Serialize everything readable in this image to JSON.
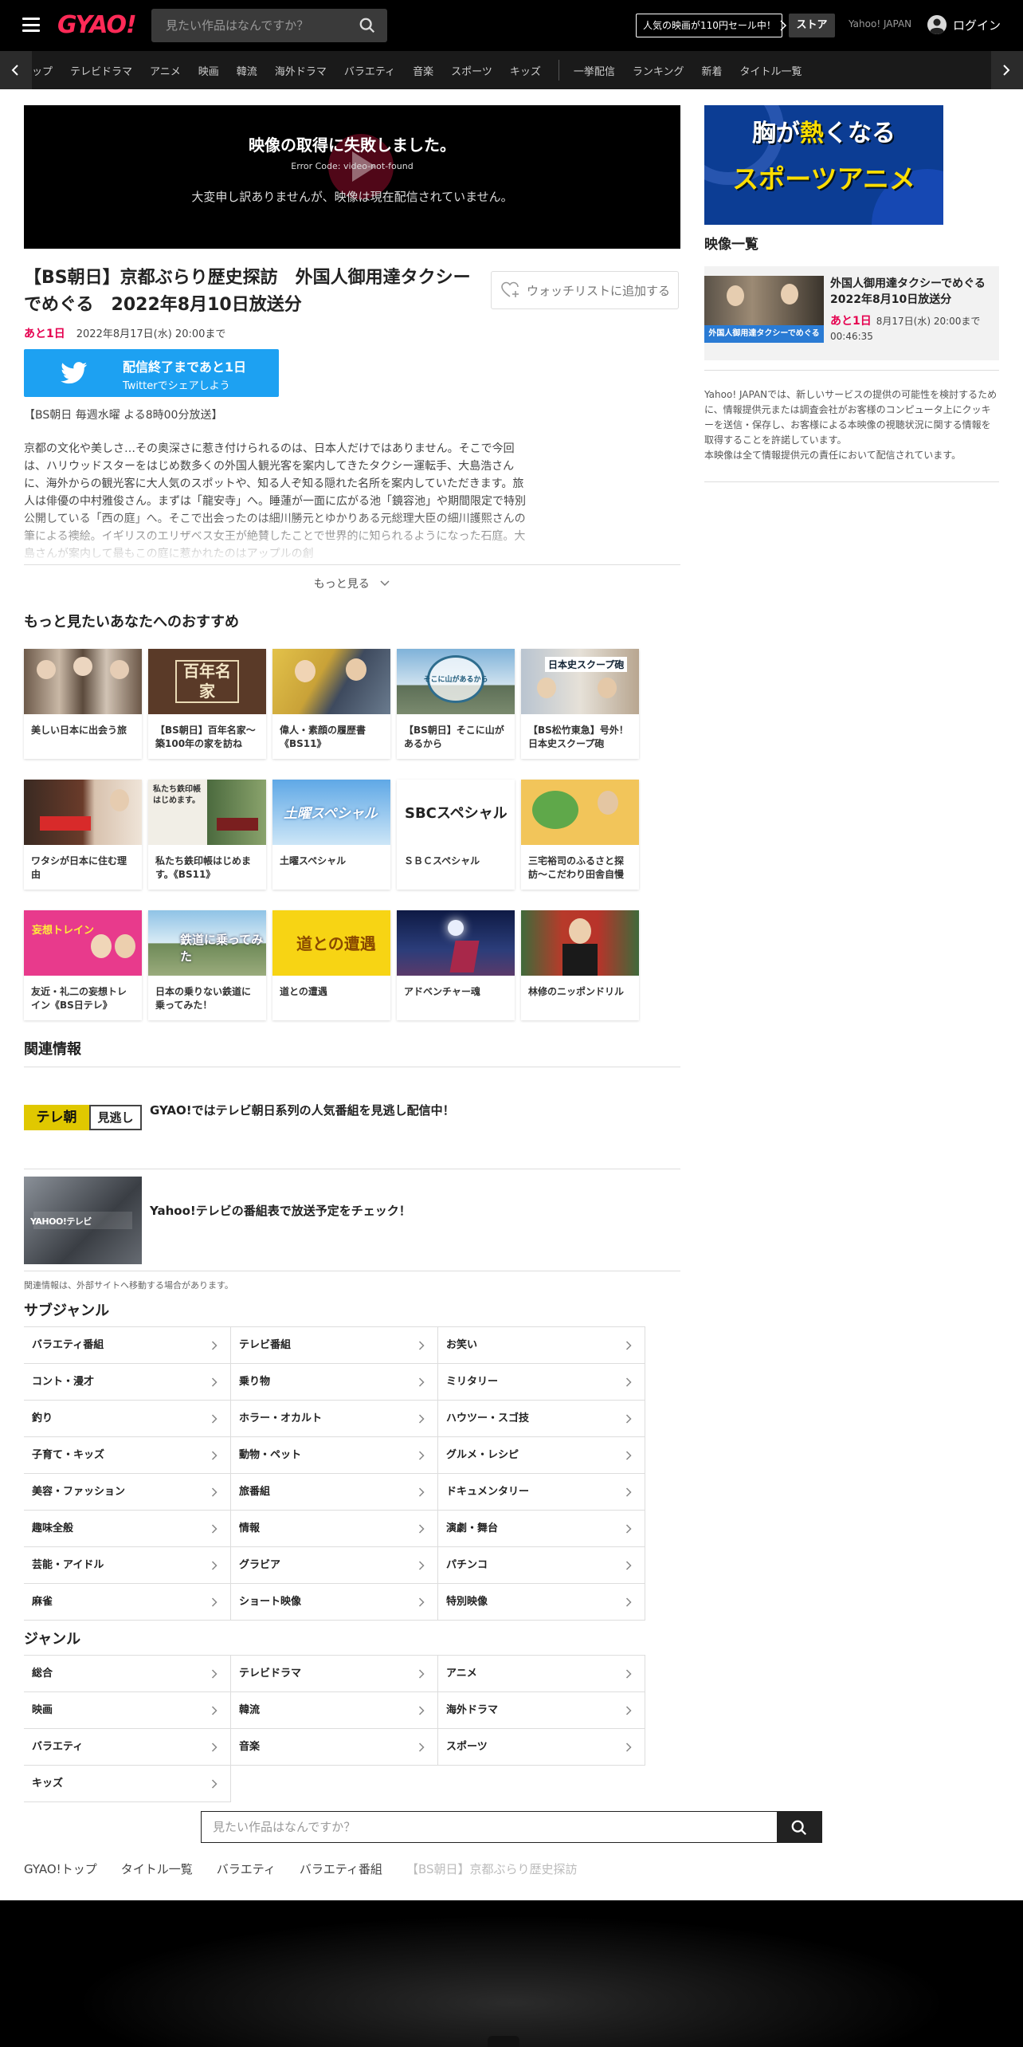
{
  "header": {
    "logo": "GYAO!",
    "search_placeholder": "見たい作品はなんですか？",
    "sale_banner": "人気の映画が110円セール中！",
    "store": "ストア",
    "yahoo_japan": "Yahoo! JAPAN",
    "login": "ログイン"
  },
  "nav": {
    "items": [
      "ップ",
      "テレビドラマ",
      "アニメ",
      "映画",
      "韓流",
      "海外ドラマ",
      "バラエティ",
      "音楽",
      "スポーツ",
      "キッズ"
    ],
    "items2": [
      "一挙配信",
      "ランキング",
      "新着",
      "タイトル一覧"
    ]
  },
  "player": {
    "error_title": "映像の取得に失敗しました。",
    "error_code": "Error Code: video-not-found",
    "error_message": "大変申し訳ありませんが、映像は現在配信されていません。"
  },
  "program": {
    "title": "【BS朝日】京都ぶらり歴史探訪　外国人御用達タクシーでめぐる　2022年8月10日放送分",
    "watchlist": "ウォッチリストに追加する",
    "remain": "あと1日",
    "until": "2022年8月17日(水) 20:00まで",
    "tweet_line1": "配信終了まであと1日",
    "tweet_line2": "Twitterでシェアしよう",
    "air_info": "【BS朝日 毎週水曜 よる8時00分放送】",
    "description": "京都の文化や美しさ…その奥深さに惹き付けられるのは、日本人だけではありません。そこで今回は、ハリウッドスターをはじめ数多くの外国人観光客を案内してきたタクシー運転手、大島浩さんに、海外からの観光客に大人気のスポットや、知る人ぞ知る隠れた名所を案内していただきます。旅人は俳優の中村雅俊さん。まずは「龍安寺」へ。睡蓮が一面に広がる池「鏡容池」や期間限定で特別公開している「西の庭」へ。そこで出会ったのは細川勝元とゆかりある元総理大臣の細川護熙さんの筆による襖絵。イギリスのエリザベス女王が絶賛したことで世界的に知られるようになった石庭。大島さんが案内して最もこの庭に惹かれたのはアップルの創",
    "more": "もっと見る"
  },
  "recommend": {
    "heading": "もっと見たいあなたへのおすすめ",
    "items": [
      "美しい日本に出会う旅",
      "【BS朝日】百年名家～築100年の家を訪ね",
      "偉人・素顔の履歴書《BS11》",
      "【BS朝日】そこに山があるから",
      "【BS松竹東急】号外！日本史スクープ砲",
      "ワタシが日本に住む理由",
      "私たち鉄印帳はじめます。《BS11》",
      "土曜スペシャル",
      "ＳＢＣスペシャル",
      "三宅裕司のふるさと探訪～こだわり田舎自慢",
      "友近・礼二の妄想トレイン《BS日テレ》",
      "日本の乗りない鉄道に乗ってみた！",
      "道との遭遇",
      "アドベンチャー魂",
      "林修のニッポンドリル"
    ],
    "thumb_text": {
      "t2": "百年名家",
      "t4": "そこに山があるから",
      "t5": "日本史スクープ砲",
      "t7": "私たち鉄印帳はじめます。",
      "t8": "土曜スペシャル",
      "t9": "SBCスペシャル",
      "t11": "妄想トレイン",
      "t12": "鉄道に乗ってみた",
      "t13": "道との遭遇"
    }
  },
  "related": {
    "heading": "関連情報",
    "item1_logo": "テレ朝",
    "item1_logo_b": "見逃し",
    "item1": "GYAO!ではテレビ朝日系列の人気番組を見逃し配信中！",
    "item2_logo": "YAHOO!テレビ",
    "item2": "Yahoo!テレビの番組表で放送予定をチェック！",
    "note": "関連情報は、外部サイトへ移動する場合があります。"
  },
  "subgenre": {
    "heading": "サブジャンル",
    "items": [
      "バラエティ番組",
      "テレビ番組",
      "お笑い",
      "コント・漫才",
      "乗り物",
      "ミリタリー",
      "釣り",
      "ホラー・オカルト",
      "ハウツー・スゴ技",
      "子育て・キッズ",
      "動物・ペット",
      "グルメ・レシピ",
      "美容・ファッション",
      "旅番組",
      "ドキュメンタリー",
      "趣味全般",
      "情報",
      "演劇・舞台",
      "芸能・アイドル",
      "グラビア",
      "パチンコ",
      "麻雀",
      "ショート映像",
      "特別映像"
    ]
  },
  "genre": {
    "heading": "ジャンル",
    "items": [
      "総合",
      "テレビドラマ",
      "アニメ",
      "映画",
      "韓流",
      "海外ドラマ",
      "バラエティ",
      "音楽",
      "スポーツ",
      "キッズ"
    ]
  },
  "bottom_search": {
    "placeholder": "見たい作品はなんですか？"
  },
  "breadcrumb": [
    "GYAO!トップ",
    "タイトル一覧",
    "バラエティ",
    "バラエティ番組",
    "【BS朝日】京都ぶらり歴史探訪"
  ],
  "sidebar": {
    "banner_line1_a": "胸が",
    "banner_line1_b": "熱",
    "banner_line1_c": "くなる",
    "banner_line2": "スポーツアニメ",
    "heading": "映像一覧",
    "episode_title": "外国人御用達タクシーでめぐる　2022年8月10日放送分",
    "episode_remain": "あと1日",
    "episode_until": "8月17日(水) 20:00まで",
    "episode_duration": "00:46:35",
    "episode_thumb_caption": "外国人御用達タクシーでめぐる",
    "notice": "Yahoo! JAPANでは、新しいサービスの提供の可能性を検討するために、情報提供元または調査会社がお客様のコンピュータ上にクッキーを送信・保存し、お客様による本映像の視聴状況に関する情報を取得することを許諾しています。\n本映像は全て情報提供元の責任において配信されています。"
  },
  "colors": {
    "accent": "#e5004f",
    "twitter": "#1da1f2",
    "logo": "#ff2a57"
  }
}
